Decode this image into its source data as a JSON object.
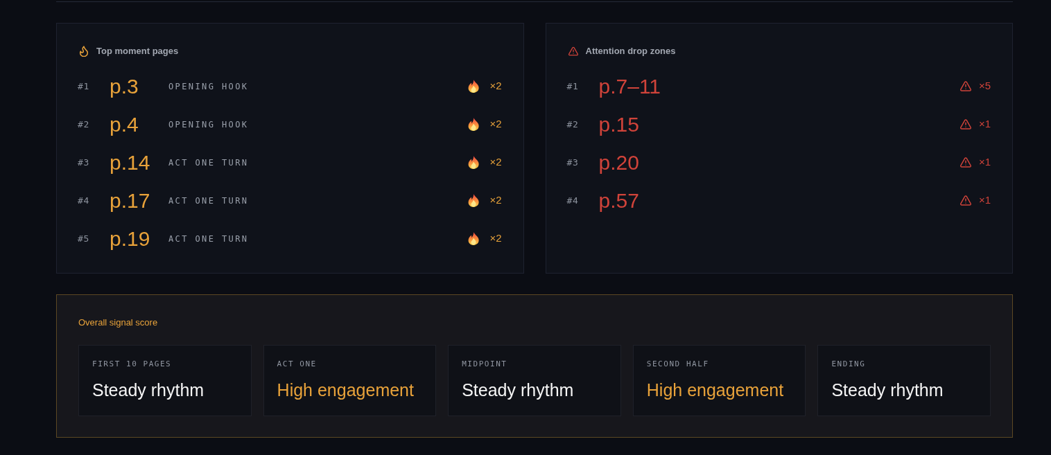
{
  "top_moments": {
    "title": "Top moment pages",
    "items": [
      {
        "rank": "#1",
        "page": "p.3",
        "label": "OPENING HOOK",
        "count": "×2"
      },
      {
        "rank": "#2",
        "page": "p.4",
        "label": "OPENING HOOK",
        "count": "×2"
      },
      {
        "rank": "#3",
        "page": "p.14",
        "label": "ACT ONE TURN",
        "count": "×2"
      },
      {
        "rank": "#4",
        "page": "p.17",
        "label": "ACT ONE TURN",
        "count": "×2"
      },
      {
        "rank": "#5",
        "page": "p.19",
        "label": "ACT ONE TURN",
        "count": "×2"
      }
    ]
  },
  "drop_zones": {
    "title": "Attention drop zones",
    "items": [
      {
        "rank": "#1",
        "page": "p.7–11",
        "count": "×5"
      },
      {
        "rank": "#2",
        "page": "p.15",
        "count": "×1"
      },
      {
        "rank": "#3",
        "page": "p.20",
        "count": "×1"
      },
      {
        "rank": "#4",
        "page": "p.57",
        "count": "×1"
      }
    ]
  },
  "signal_score": {
    "title": "Overall signal score",
    "segments": [
      {
        "label": "FIRST 10 PAGES",
        "value": "Steady rhythm",
        "highlighted": false
      },
      {
        "label": "ACT ONE",
        "value": "High engagement",
        "highlighted": true
      },
      {
        "label": "MIDPOINT",
        "value": "Steady rhythm",
        "highlighted": false
      },
      {
        "label": "SECOND HALF",
        "value": "High engagement",
        "highlighted": true
      },
      {
        "label": "ENDING",
        "value": "Steady rhythm",
        "highlighted": false
      }
    ]
  }
}
